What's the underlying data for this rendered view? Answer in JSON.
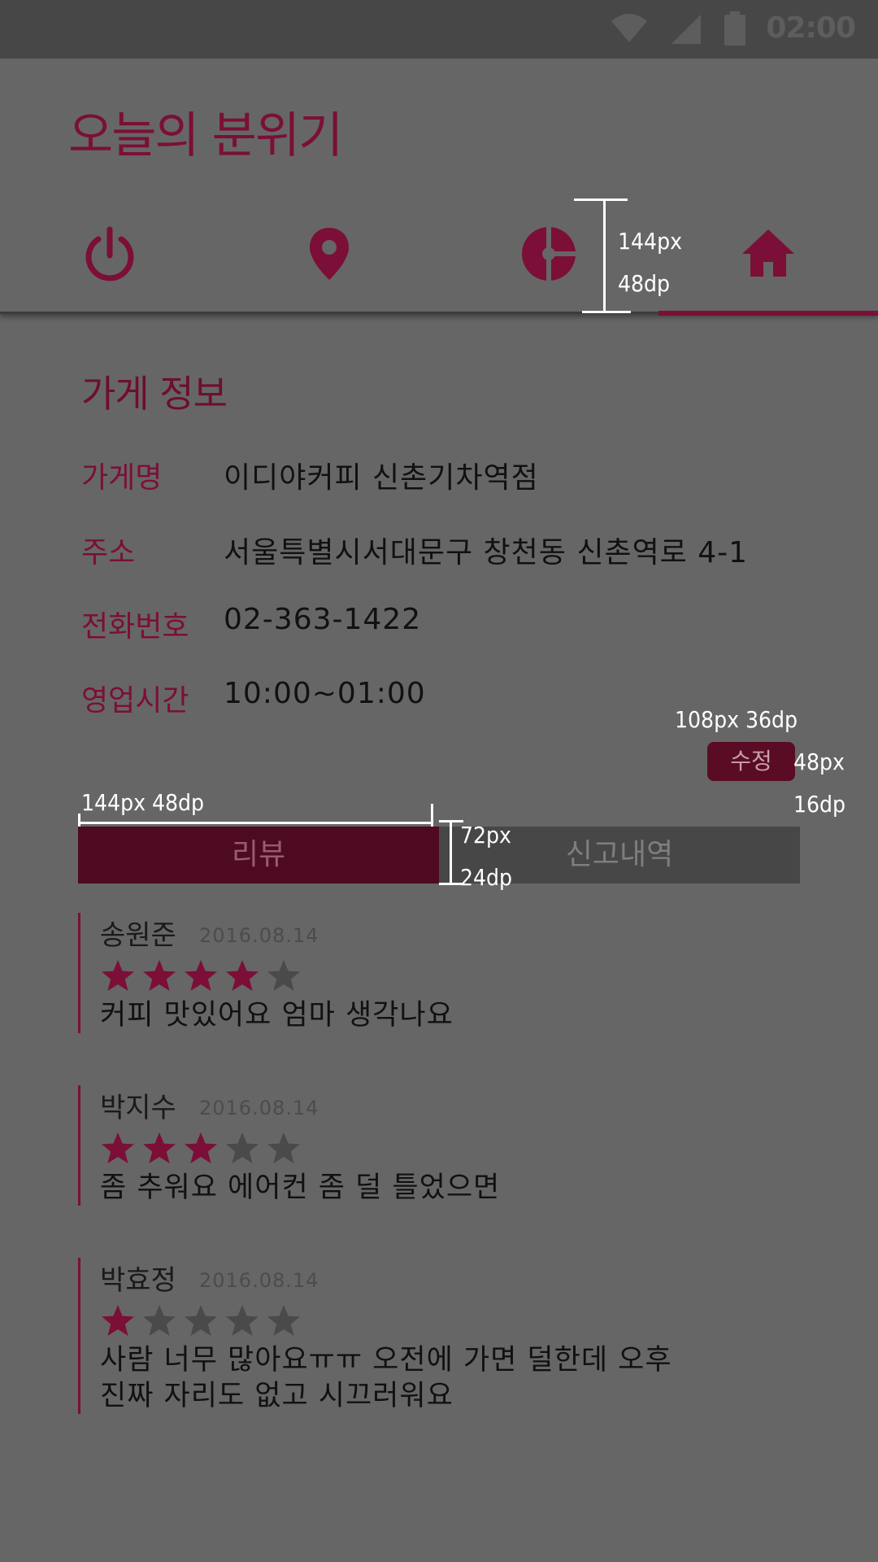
{
  "status_bar": {
    "time": "02:00",
    "icons": [
      "wifi-icon",
      "signal-icon",
      "battery-icon"
    ],
    "color": "#474747"
  },
  "app": {
    "title": "오늘의 분위기",
    "accent": "#7b0f37"
  },
  "tabs": [
    {
      "icon": "power-icon",
      "selected": false
    },
    {
      "icon": "location-pin-icon",
      "selected": false
    },
    {
      "icon": "pie-chart-icon",
      "selected": false
    },
    {
      "icon": "home-icon",
      "selected": true
    }
  ],
  "annotations": {
    "tab_height_px": "144px",
    "tab_height_dp": "48dp",
    "button_width": "108px  36dp",
    "button_height_px": "48px",
    "button_height_dp": "16dp",
    "segment_width": "144px  48dp",
    "segment_height_px": "72px",
    "segment_height_dp": "24dp"
  },
  "store": {
    "section_title": "가게 정보",
    "rows": [
      {
        "label": "가게명",
        "value": "이디야커피 신촌기차역점"
      },
      {
        "label": "주소",
        "value": "서울특별시서대문구 창천동 신촌역로 4-1"
      },
      {
        "label": "전화번호",
        "value": "02-363-1422"
      },
      {
        "label": "영업시간",
        "value": "10:00~01:00"
      }
    ],
    "edit_label": "수정"
  },
  "segments": {
    "review_label": "리뷰",
    "report_label": "신고내역",
    "selected": "review"
  },
  "reviews": [
    {
      "name": "송원준",
      "date": "2016.08.14",
      "rating": 4,
      "text": "커피 맛있어요 엄마 생각나요"
    },
    {
      "name": "박지수",
      "date": "2016.08.14",
      "rating": 3,
      "text": "좀 추워요 에어컨 좀 덜 틀었으면"
    },
    {
      "name": "박효정",
      "date": "2016.08.14",
      "rating": 1,
      "text_lines": [
        "사람 너무 많아요ㅠㅠ 오전에 가면 덜한데 오후",
        "진짜 자리도 없고 시끄러워요"
      ]
    }
  ],
  "colors": {
    "background": "#666666",
    "star_filled": "#7b0f37",
    "star_empty": "#4a4a4a"
  }
}
